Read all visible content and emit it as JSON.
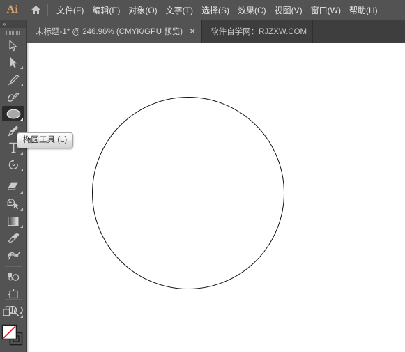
{
  "app": {
    "name": "Ai",
    "logo_color": "#d9a06a"
  },
  "menubar": {
    "home_icon": "home-icon",
    "items": [
      {
        "label": "文件(F)"
      },
      {
        "label": "编辑(E)"
      },
      {
        "label": "对象(O)"
      },
      {
        "label": "文字(T)"
      },
      {
        "label": "选择(S)"
      },
      {
        "label": "效果(C)"
      },
      {
        "label": "视图(V)"
      },
      {
        "label": "窗口(W)"
      },
      {
        "label": "帮助(H)"
      }
    ]
  },
  "tabbar": {
    "tabs": [
      {
        "title": "未标题-1* @ 246.96% (CMYK/GPU 预览)",
        "close_label": "✕",
        "active": true
      },
      {
        "title": "软件自学网：RJZXW.COM",
        "active": false
      }
    ]
  },
  "toolbar": {
    "expand_label": "»",
    "tools": [
      {
        "name": "selection-tool",
        "icon": "arrow-cursor-icon",
        "has_flyout": false,
        "selected": false
      },
      {
        "name": "direct-selection-tool",
        "icon": "direct-select-arrow-icon",
        "has_flyout": true,
        "selected": false
      },
      {
        "name": "pen-tool",
        "icon": "pen-icon",
        "has_flyout": true,
        "selected": false
      },
      {
        "name": "curvature-tool",
        "icon": "curvature-pen-icon",
        "has_flyout": false,
        "selected": false
      },
      {
        "name": "ellipse-tool",
        "icon": "ellipse-icon",
        "has_flyout": true,
        "selected": true
      },
      {
        "name": "paintbrush-tool",
        "icon": "paintbrush-icon",
        "has_flyout": true,
        "selected": false
      },
      {
        "name": "type-tool",
        "icon": "type-t-icon",
        "has_flyout": true,
        "selected": false
      },
      {
        "name": "rotate-tool",
        "icon": "rotate-icon",
        "has_flyout": true,
        "selected": false
      },
      {
        "name": "eraser-tool",
        "icon": "eraser-icon",
        "has_flyout": true,
        "selected": false
      },
      {
        "name": "shape-builder-tool",
        "icon": "shape-builder-icon",
        "has_flyout": true,
        "selected": false
      },
      {
        "name": "gradient-tool",
        "icon": "gradient-icon",
        "has_flyout": true,
        "selected": false
      },
      {
        "name": "eyedropper-tool",
        "icon": "eyedropper-icon",
        "has_flyout": false,
        "selected": false
      },
      {
        "name": "blend-tool",
        "icon": "blend-ribbon-icon",
        "has_flyout": false,
        "selected": false
      },
      {
        "name": "symbol-sprayer-tool",
        "icon": "symbol-sprayer-icon",
        "has_flyout": false,
        "selected": false
      },
      {
        "name": "artboard-tool",
        "icon": "artboard-crop-icon",
        "has_flyout": false,
        "selected": false
      },
      {
        "name": "zoom-tool",
        "icon": "magnifier-icon",
        "has_flyout": true,
        "selected": false
      }
    ],
    "screen_mode_icon": "change-screen-mode-icon",
    "swap_icon": "swap-fill-stroke-icon",
    "fill_color": "#ffffff",
    "stroke_color": "#000000",
    "none_slash_color": "#e21b1b"
  },
  "tooltip": {
    "label": "椭圆工具",
    "shortcut": "(L)"
  },
  "canvas": {
    "background": "#ffffff",
    "shape": {
      "name": "ellipse",
      "stroke_color": "#111111",
      "fill": "none",
      "stroke_width": "1.6px"
    }
  }
}
